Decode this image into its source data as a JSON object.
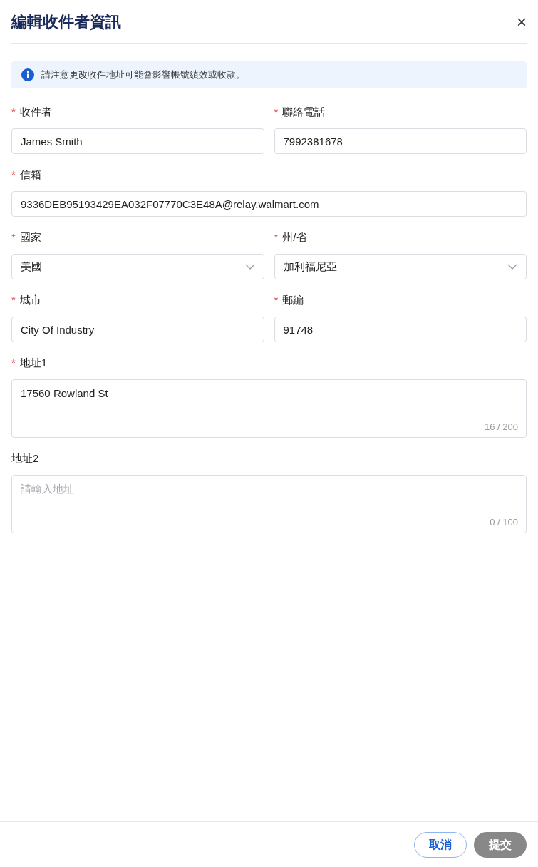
{
  "dialog": {
    "title": "編輯收件者資訊",
    "close": "×"
  },
  "notice": "請注意更改收件地址可能會影響帳號績效或收款。",
  "rows": [
    [
      {
        "label": "收件者",
        "required_mark": "*",
        "kind": "text",
        "value": "James Smith"
      },
      {
        "label": "聯絡電話",
        "required_mark": "*",
        "kind": "text",
        "value": "7992381678"
      }
    ],
    [
      {
        "label": "信箱",
        "required_mark": "*",
        "kind": "text",
        "value": "9336DEB95193429EA032F07770C3E48A@relay.walmart.com"
      }
    ],
    [
      {
        "label": "國家",
        "required_mark": "*",
        "kind": "select",
        "value": "美國"
      },
      {
        "label": "州/省",
        "required_mark": "*",
        "kind": "select",
        "value": "加利福尼亞"
      }
    ],
    [
      {
        "label": "城市",
        "required_mark": "*",
        "kind": "text",
        "value": "City Of Industry"
      },
      {
        "label": "郵編",
        "required_mark": "*",
        "kind": "text",
        "value": "91748"
      }
    ],
    [
      {
        "label": "地址1",
        "required_mark": "*",
        "kind": "textarea",
        "value": "17560 Rowland St",
        "counter": "16 / 200"
      }
    ],
    [
      {
        "label": "地址2",
        "kind": "textarea",
        "placeholder": "請輸入地址",
        "counter": "0 / 100"
      }
    ]
  ],
  "buttons": [
    {
      "label": "取消",
      "kind": "secondary",
      "disabled": false
    },
    {
      "label": "提交",
      "kind": "primary",
      "disabled": true
    }
  ]
}
